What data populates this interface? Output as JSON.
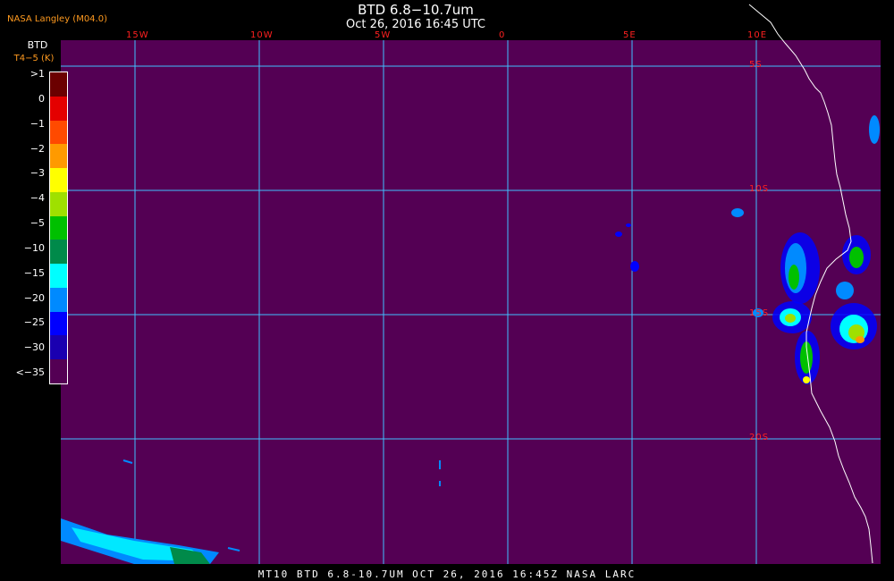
{
  "header": {
    "title": "BTD 6.8−10.7um",
    "subtitle": "Oct 26, 2016 16:45 UTC",
    "credit": "NASA Langley (M04.0)"
  },
  "legend": {
    "title": "BTD",
    "unit": "T4−5 (K)",
    "entries": [
      {
        "label": ">1",
        "color": "#6b0000"
      },
      {
        "label": "0",
        "color": "#e40000"
      },
      {
        "label": "−1",
        "color": "#ff4a00"
      },
      {
        "label": "−2",
        "color": "#ff9a00"
      },
      {
        "label": "−3",
        "color": "#ffff00"
      },
      {
        "label": "−4",
        "color": "#9fe000"
      },
      {
        "label": "−5",
        "color": "#00c000"
      },
      {
        "label": "−10",
        "color": "#008a4a"
      },
      {
        "label": "−15",
        "color": "#00ffff"
      },
      {
        "label": "−20",
        "color": "#008aff"
      },
      {
        "label": "−25",
        "color": "#0000ff"
      },
      {
        "label": "−30",
        "color": "#1a00b0"
      },
      {
        "label": "<−35",
        "color": "#540054"
      }
    ]
  },
  "grid": {
    "longitudes": [
      {
        "label": "15W",
        "value": -15
      },
      {
        "label": "10W",
        "value": -10
      },
      {
        "label": "5W",
        "value": -5
      },
      {
        "label": "0",
        "value": 0
      },
      {
        "label": "5E",
        "value": 5
      },
      {
        "label": "10E",
        "value": 10
      }
    ],
    "latitudes": [
      {
        "label": "5S",
        "value": -5
      },
      {
        "label": "10S",
        "value": -10
      },
      {
        "label": "15S",
        "value": -15
      },
      {
        "label": "20S",
        "value": -20
      }
    ]
  },
  "colors": {
    "background": "#540054",
    "gridline": "#40c0ff",
    "coastline": "#ffffff",
    "label_red": "#ff2020",
    "label_orange": "#ff9a1f"
  },
  "footer": {
    "text": "MT10  BTD 6.8-10.7UM  OCT 26, 2016 16:45Z  NASA LARC"
  }
}
